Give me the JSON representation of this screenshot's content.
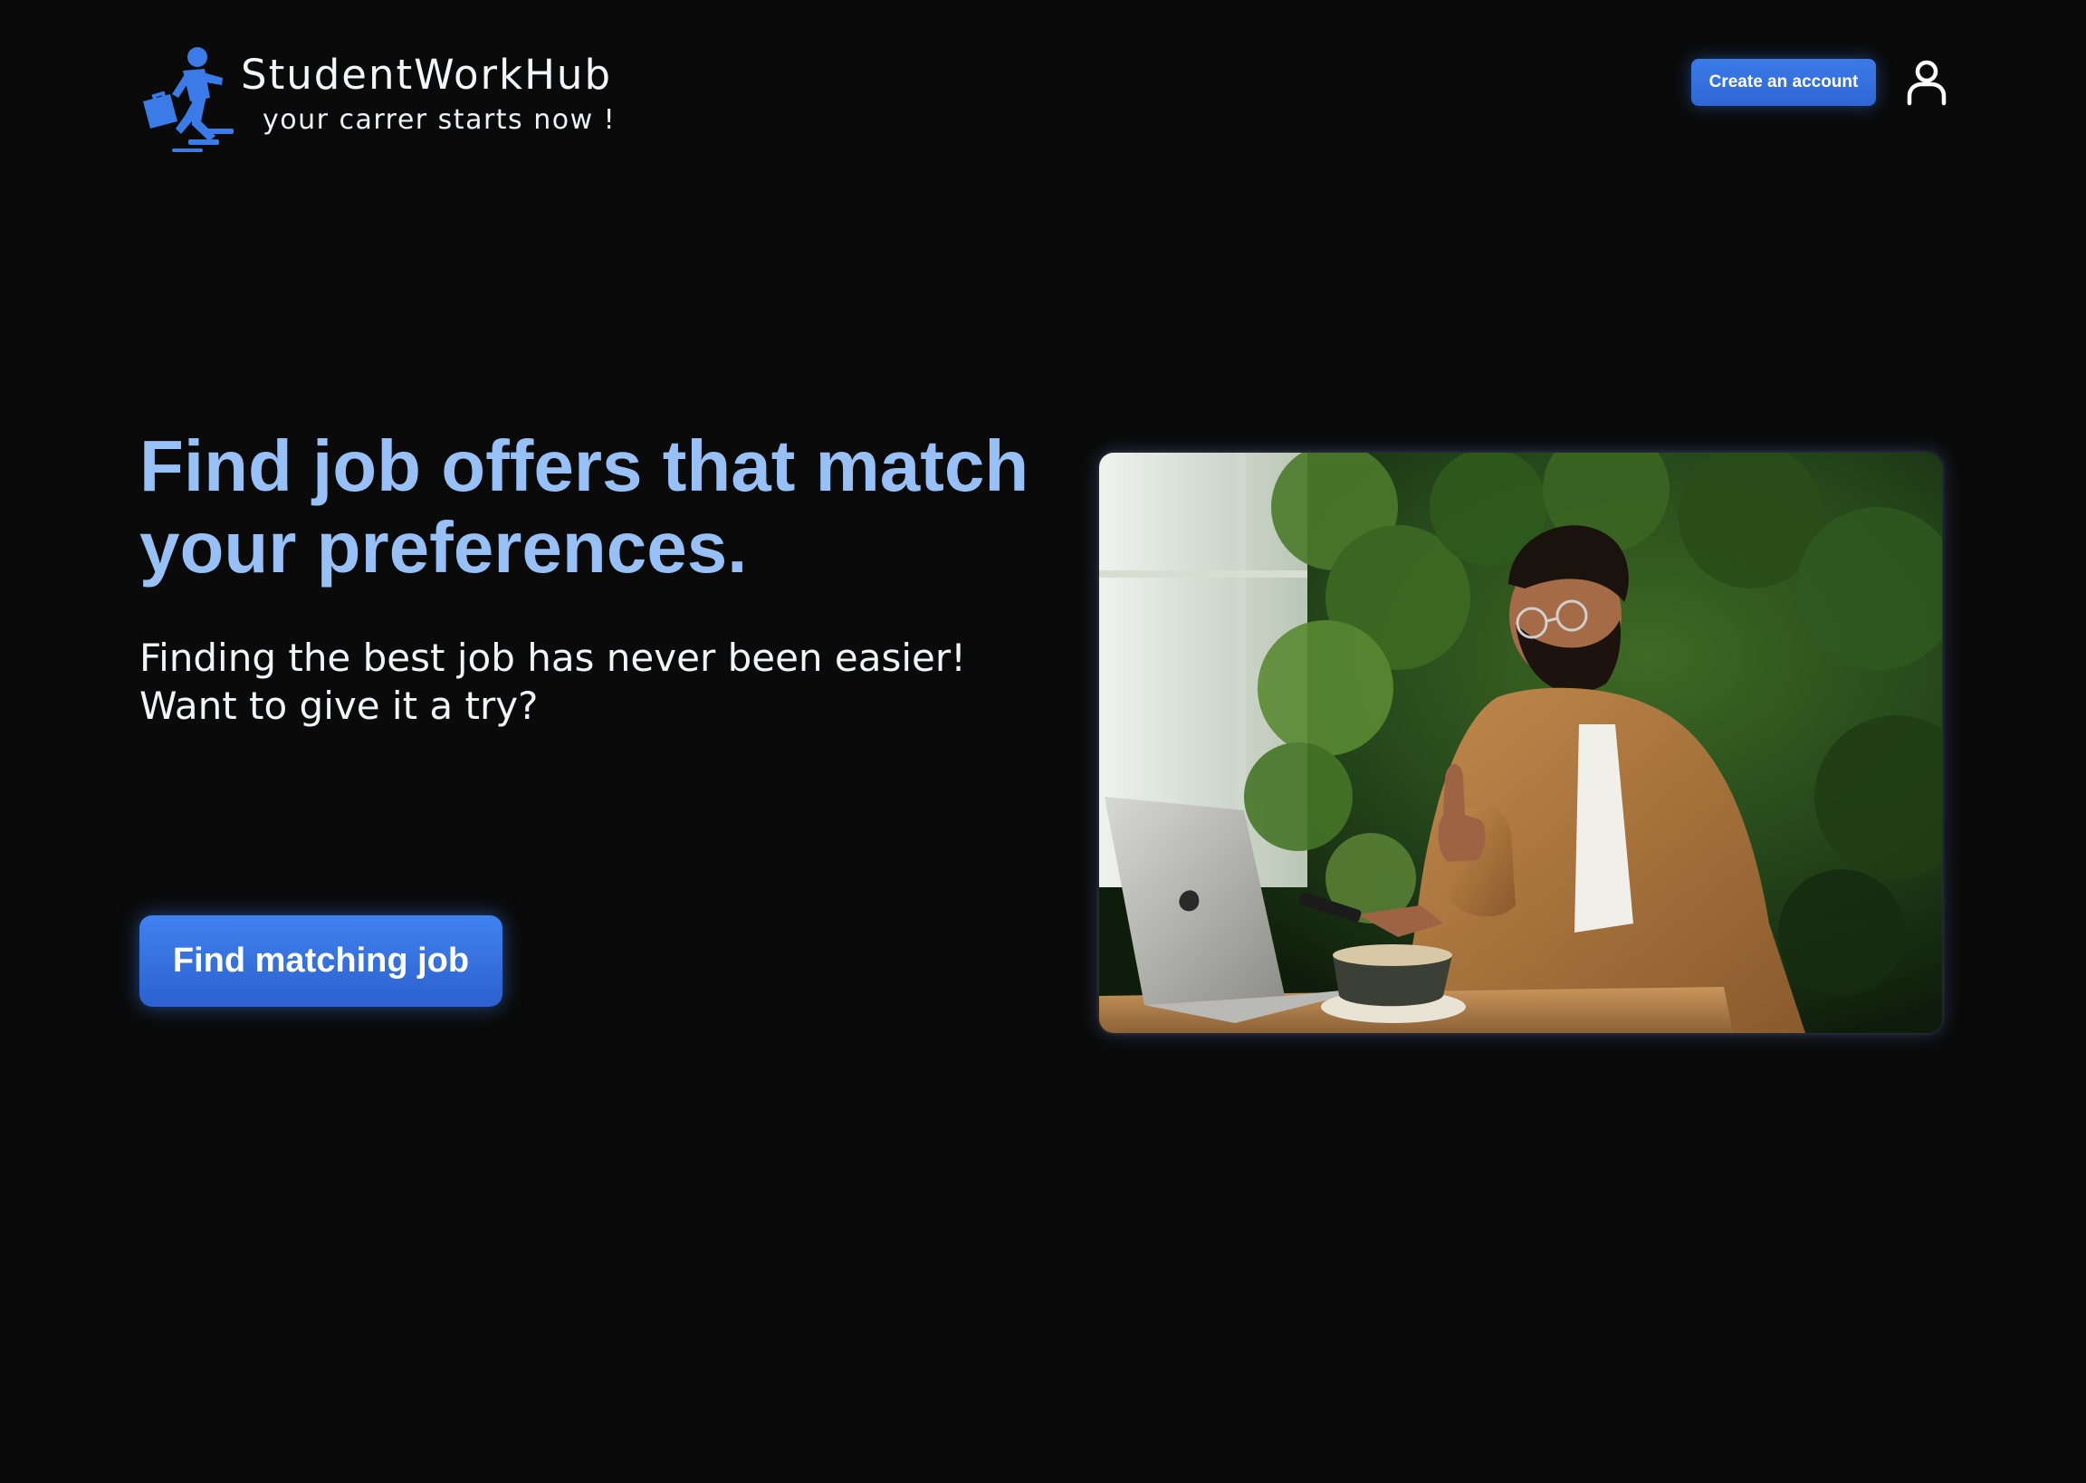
{
  "brand": {
    "name": "StudentWorkHub",
    "tagline": "your carrer starts now !"
  },
  "header": {
    "create_account_label": "Create an account"
  },
  "hero": {
    "heading": "Find job offers that match your preferences.",
    "subtitle_line1": "Finding the best job has never been easier!",
    "subtitle_line2": "Want to give it a try?",
    "cta_label": "Find matching job"
  },
  "colors": {
    "background": "#0a0a0a",
    "accent": "#3b7be8",
    "heading": "#97c0f6",
    "text": "#f2f4f8"
  },
  "icons": {
    "logo": "running-worker-with-briefcase-logo",
    "account": "user-icon"
  }
}
